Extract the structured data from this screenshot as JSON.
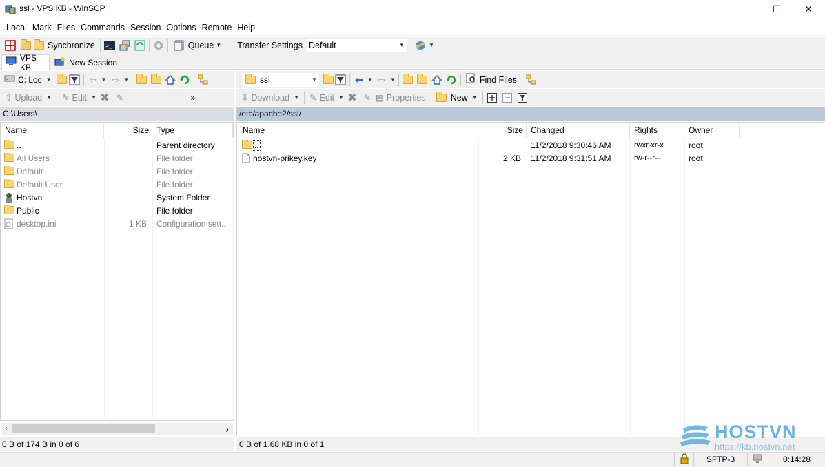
{
  "window": {
    "title": "ssl - VPS KB - WinSCP",
    "minimize": "—",
    "maximize": "☐",
    "close": "✕"
  },
  "menu": [
    "Local",
    "Mark",
    "Files",
    "Commands",
    "Session",
    "Options",
    "Remote",
    "Help"
  ],
  "toolbar": {
    "synchronize": "Synchronize",
    "queue": "Queue",
    "transfer_settings_label": "Transfer Settings",
    "transfer_settings_value": "Default"
  },
  "tabs": [
    {
      "label": "VPS KB",
      "icon": "computer-icon"
    },
    {
      "label": "New Session",
      "icon": "new-session-icon"
    }
  ],
  "local": {
    "drive": "C: Loc",
    "path": "C:\\Users\\",
    "actions": {
      "upload": "Upload",
      "edit": "Edit"
    },
    "columns": [
      "Name",
      "Size",
      "Type"
    ],
    "rows": [
      {
        "name": "..",
        "size": "",
        "type": "Parent directory",
        "icon": "parent-dir-icon",
        "hidden": false
      },
      {
        "name": "All Users",
        "size": "",
        "type": "File folder",
        "icon": "folder-icon",
        "hidden": true
      },
      {
        "name": "Default",
        "size": "",
        "type": "File folder",
        "icon": "folder-icon",
        "hidden": true
      },
      {
        "name": "Default User",
        "size": "",
        "type": "File folder",
        "icon": "folder-icon",
        "hidden": true
      },
      {
        "name": "Hostvn",
        "size": "",
        "type": "System Folder",
        "icon": "user-folder-icon",
        "hidden": false
      },
      {
        "name": "Public",
        "size": "",
        "type": "File folder",
        "icon": "folder-icon",
        "hidden": false
      },
      {
        "name": "desktop.ini",
        "size": "1 KB",
        "type": "Configuration sett...",
        "icon": "config-file-icon",
        "hidden": true
      }
    ],
    "status": "0 B of 174 B in 0 of 6"
  },
  "remote": {
    "dir": "ssl",
    "path": "/etc/apache2/ssl/",
    "find_files": "Find Files",
    "actions": {
      "download": "Download",
      "edit": "Edit",
      "properties": "Properties",
      "new": "New"
    },
    "columns": [
      "Name",
      "Size",
      "Changed",
      "Rights",
      "Owner"
    ],
    "rows": [
      {
        "name": "..",
        "size": "",
        "changed": "11/2/2018 9:30:46 AM",
        "rights": "rwxr-xr-x",
        "owner": "root",
        "icon": "parent-dir-icon"
      },
      {
        "name": "hostvn-prikey.key",
        "size": "2 KB",
        "changed": "11/2/2018 9:31:51 AM",
        "rights": "rw-r--r--",
        "owner": "root",
        "icon": "file-icon"
      }
    ],
    "status": "0 B of 1.68 KB in 0 of 1"
  },
  "statusbar": {
    "protocol": "SFTP-3",
    "time": "0:14:28"
  },
  "watermark": {
    "brand": "HOSTVN",
    "url": "https://kb.hostvn.net"
  }
}
